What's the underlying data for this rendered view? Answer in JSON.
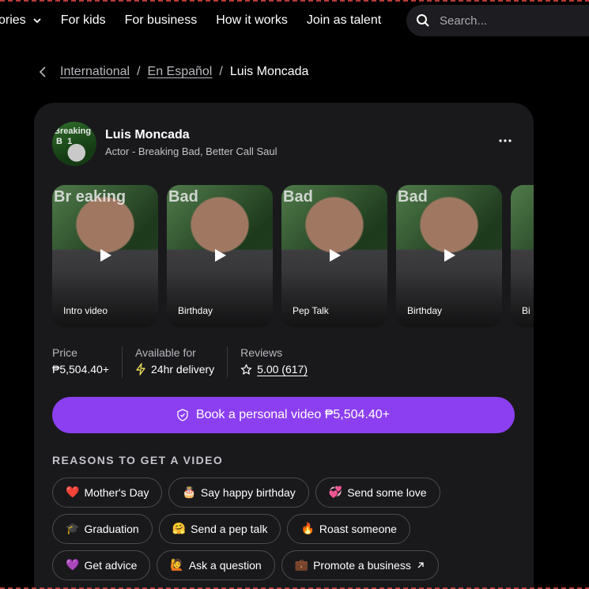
{
  "nav": {
    "items": [
      "ories",
      "For kids",
      "For business",
      "How it works",
      "Join as talent"
    ],
    "search_placeholder": "Search..."
  },
  "breadcrumb": {
    "items": [
      "International",
      "En Español"
    ],
    "current": "Luis Moncada"
  },
  "profile": {
    "name": "Luis Moncada",
    "subtitle": "Actor - Breaking Bad, Better Call Saul",
    "avatar_text": "Breaking B​..1"
  },
  "videos": [
    {
      "label": "Intro video",
      "overlay": "Br eaking"
    },
    {
      "label": "Birthday",
      "overlay": "Bad"
    },
    {
      "label": "Pep Talk",
      "overlay": "Bad"
    },
    {
      "label": "Birthday",
      "overlay": "Bad"
    },
    {
      "label": "Bi",
      "overlay": ""
    }
  ],
  "stats": {
    "price_label": "Price",
    "price_value": "₱5,504.40+",
    "availability_label": "Available for",
    "availability_value": "24hr delivery",
    "reviews_label": "Reviews",
    "reviews_value": "5.00 (617)"
  },
  "cta": {
    "label": "Book a personal video ₱5,504.40+"
  },
  "reasons": {
    "title": "REASONS TO GET A VIDEO",
    "chips": [
      {
        "emoji": "❤️",
        "label": "Mother's Day"
      },
      {
        "emoji": "🎂",
        "label": "Say happy birthday"
      },
      {
        "emoji": "💞",
        "label": "Send some love"
      },
      {
        "emoji": "🎓",
        "label": "Graduation"
      },
      {
        "emoji": "🤗",
        "label": "Send a pep talk"
      },
      {
        "emoji": "🔥",
        "label": "Roast someone"
      },
      {
        "emoji": "💜",
        "label": "Get advice"
      },
      {
        "emoji": "🙋",
        "label": "Ask a question"
      },
      {
        "emoji": "💼",
        "label": "Promote a business"
      }
    ]
  },
  "colors": {
    "accent": "#8c3ff0",
    "card_bg": "#19191c",
    "page_bg": "#000000"
  }
}
